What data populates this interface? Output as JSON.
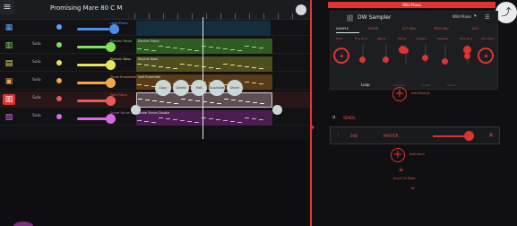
{
  "header": {
    "project_title": "Promising Mare 80 C M",
    "menu_label": "≡"
  },
  "tracks": [
    {
      "num": "",
      "name": "Lead Piano",
      "dot": "#54a6ff",
      "bar": "#4b8fe6",
      "icon": "grid-icon",
      "clip_label": "",
      "clip_color": "#143245"
    },
    {
      "num": "Solo",
      "name": "Electric Piano",
      "dot": "#7ee25c",
      "bar": "#7ee25c",
      "icon": "piano-icon",
      "clip_label": "Electric Piano",
      "clip_color": "#2f5a22"
    },
    {
      "num": "Solo",
      "name": "Electric Bass",
      "dot": "#e4e65a",
      "bar": "#e4e65a",
      "icon": "bass-icon",
      "clip_label": "Electric Bass",
      "clip_color": "#4e4f1f"
    },
    {
      "num": "Solo",
      "name": "Drum Ensemble",
      "dot": "#f3a64a",
      "bar": "#f3a64a",
      "icon": "drum-icon",
      "clip_label": "Soft Ensemble",
      "clip_color": "#5a3b17"
    },
    {
      "num": "Solo",
      "name": "Wild Piano",
      "dot": "#e85b56",
      "bar": "#e85b56",
      "icon": "piano-icon",
      "clip_label": "",
      "clip_color": "#5a2b2a"
    },
    {
      "num": "Solo",
      "name": "Snare Strum Double",
      "dot": "#d66ae1",
      "bar": "#d66ae1",
      "icon": "strum-icon",
      "clip_label": "Snare Strum Double",
      "clip_color": "#4a1f50"
    }
  ],
  "context_buttons": [
    "Copy",
    "Delete",
    "Edit",
    "Duplicate",
    "Share"
  ],
  "rack": {
    "header": "Wild Piano",
    "device_title": "DW Sampler",
    "preset": "Wild Piano",
    "tabs": [
      "SAMPLE",
      "FILTER",
      "VCF ENV",
      "TRIG ENV",
      "LFO"
    ],
    "params": [
      "Pitch",
      "Fine Tune",
      "Attack",
      "Decay",
      "Sustain",
      "Release",
      "Fine Tune",
      "LFO Ampl"
    ],
    "loop_label": "Loop",
    "step_labels": [
      "Remove",
      "Length",
      "Speed"
    ],
    "add_module": "Add Module"
  },
  "sends": {
    "label": "SENDS",
    "row": {
      "value": "0dB",
      "target": "MASTER",
      "level": 0.9
    },
    "add_send": "Add Send"
  },
  "scroll": {
    "label": "Scroll Of Slide"
  }
}
